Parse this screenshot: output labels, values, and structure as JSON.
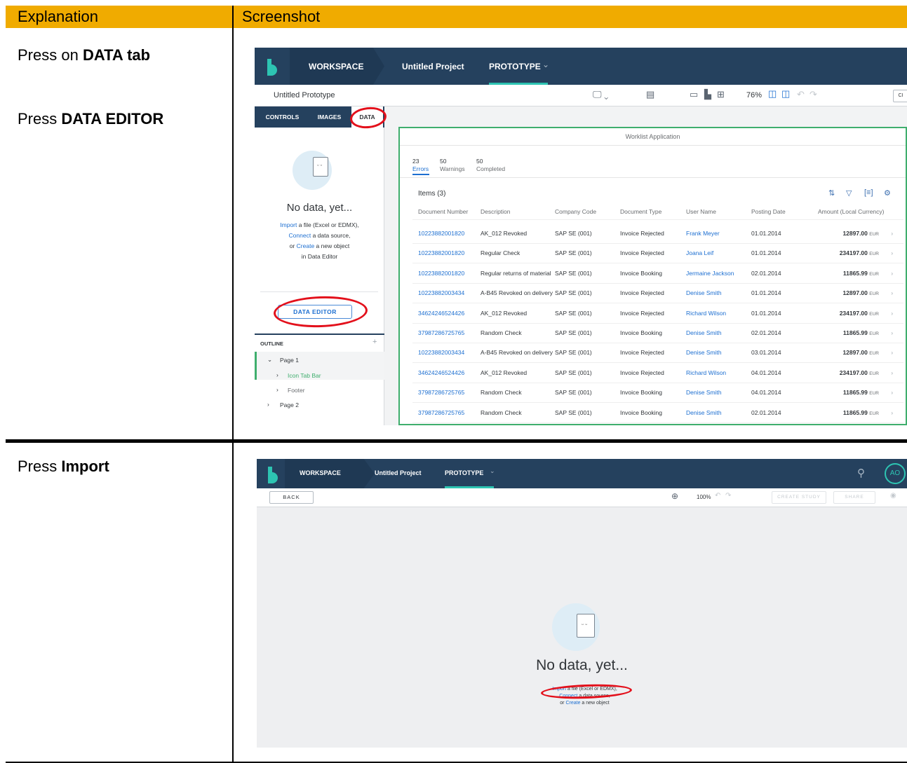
{
  "table": {
    "header_explanation": "Explanation",
    "header_screenshot": "Screenshot"
  },
  "steps": [
    {
      "pre": "Press on ",
      "bold": "DATA tab"
    },
    {
      "pre": "Press ",
      "bold": "DATA EDITOR"
    },
    {
      "pre": "Press ",
      "bold": "Import"
    }
  ],
  "shot1": {
    "nav": {
      "workspace": "WORKSPACE",
      "project": "Untitled Project",
      "prototype": "PROTOTYPE",
      "prototype_caret": "⌄"
    },
    "toolbar": {
      "title": "Untitled Prototype",
      "zoom": "76%",
      "cut_button": "CI"
    },
    "tabs": [
      "CONTROLS",
      "IMAGES",
      "DATA"
    ],
    "empty": {
      "title": "No data, yet...",
      "import_link": "Import",
      "import_rest": " a file (Excel or EDMX),",
      "connect_link": "Connect",
      "connect_rest": " a data source,",
      "or_text": "or ",
      "create_link": "Create",
      "create_rest": " a new object",
      "in_editor": "in Data Editor"
    },
    "data_editor_button": "DATA EDITOR",
    "outline": {
      "title": "OUTLINE",
      "add": "+",
      "items": [
        {
          "chev": "⌄",
          "label": "Page 1"
        },
        {
          "chev": "›",
          "label": "Icon Tab Bar"
        },
        {
          "chev": "›",
          "label": "Footer"
        },
        {
          "chev": "›",
          "label": "Page 2"
        }
      ]
    },
    "app": {
      "title": "Worklist Application",
      "stats": [
        {
          "num": "23",
          "label": "Errors"
        },
        {
          "num": "50",
          "label": "Warnings"
        },
        {
          "num": "50",
          "label": "Completed"
        }
      ],
      "items_title": "Items (3)",
      "columns": [
        "Document Number",
        "Description",
        "Company Code",
        "Document Type",
        "User Name",
        "Posting Date",
        "Amount (Local Currency)"
      ],
      "currency": "EUR",
      "rows": [
        [
          "10223882001820",
          "AK_012 Revoked",
          "SAP SE (001)",
          "Invoice Rejected",
          "Frank Meyer",
          "01.01.2014",
          "12897.00"
        ],
        [
          "10223882001820",
          "Regular Check",
          "SAP SE (001)",
          "Invoice Rejected",
          "Joana Leif",
          "01.01.2014",
          "234197.00"
        ],
        [
          "10223882001820",
          "Regular returns of material",
          "SAP SE (001)",
          "Invoice Booking",
          "Jermaine Jackson",
          "02.01.2014",
          "11865.99"
        ],
        [
          "10223882003434",
          "A-B45 Revoked on delivery",
          "SAP SE (001)",
          "Invoice Rejected",
          "Denise Smith",
          "01.01.2014",
          "12897.00"
        ],
        [
          "34624246524426",
          "AK_012 Revoked",
          "SAP SE (001)",
          "Invoice Rejected",
          "Richard Wilson",
          "01.01.2014",
          "234197.00"
        ],
        [
          "37987286725765",
          "Random Check",
          "SAP SE (001)",
          "Invoice Booking",
          "Denise Smith",
          "02.01.2014",
          "11865.99"
        ],
        [
          "10223882003434",
          "A-B45 Revoked on delivery",
          "SAP SE (001)",
          "Invoice Rejected",
          "Denise Smith",
          "03.01.2014",
          "12897.00"
        ],
        [
          "34624246524426",
          "AK_012 Revoked",
          "SAP SE (001)",
          "Invoice Rejected",
          "Richard Wilson",
          "04.01.2014",
          "234197.00"
        ],
        [
          "37987286725765",
          "Random Check",
          "SAP SE (001)",
          "Invoice Booking",
          "Denise Smith",
          "04.01.2014",
          "11865.99"
        ],
        [
          "37987286725765",
          "Random Check",
          "SAP SE (001)",
          "Invoice Booking",
          "Denise Smith",
          "02.01.2014",
          "11865.99"
        ]
      ]
    }
  },
  "shot2": {
    "nav": {
      "workspace": "WORKSPACE",
      "project": "Untitled Project",
      "prototype": "PROTOTYPE",
      "prototype_caret": "⌄",
      "avatar": "AO"
    },
    "toolbar": {
      "back": "BACK",
      "zoom": "100%",
      "create_study": "CREATE STUDY",
      "share": "SHARE"
    },
    "empty": {
      "title": "No data, yet...",
      "import_link": "Import",
      "import_rest": " a file (Excel or EDMX),",
      "connect_link": "Connect",
      "connect_rest": " a data source,",
      "or_text": "or ",
      "create_link": "Create",
      "create_rest": " a new object"
    }
  },
  "colors": {
    "header": "#f0ab00",
    "nav": "#25415e",
    "accent": "#2dc4b2",
    "link": "#1d6fd1",
    "annotation": "#e3101b"
  }
}
